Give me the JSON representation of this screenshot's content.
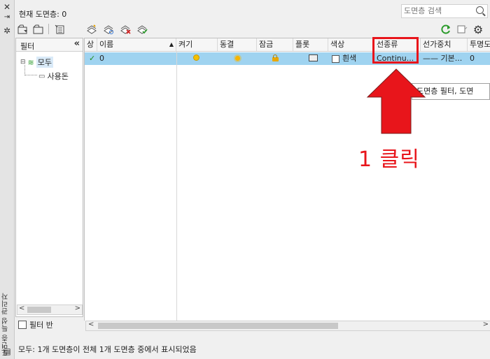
{
  "palette_title": "도면층 특성 관리자",
  "current_layer_label": "현재 도면층: 0",
  "search": {
    "placeholder": "도면층 검색"
  },
  "filter_panel": {
    "header": "필터",
    "tree": [
      {
        "label": "모두",
        "selected": true
      },
      {
        "label": "사용돈"
      }
    ],
    "invert_filter_label": "필터 반"
  },
  "table": {
    "columns": [
      "상",
      "이름",
      "켜기",
      "동결",
      "잠금",
      "플롯",
      "색상",
      "선종류",
      "선가중치",
      "투명도"
    ],
    "rows": [
      {
        "status": "current",
        "name": "0",
        "on": "bulb-on",
        "freeze": "sun-thawed",
        "lock": "unlocked",
        "plot": "printer",
        "color": "흰색",
        "linetype": "Continu...",
        "lineweight": "—— 기본...",
        "transparency": "0"
      }
    ]
  },
  "tooltip": "도면층 필터, 도면",
  "annotation": {
    "text": "1 클릭",
    "color": "#e8151b"
  },
  "status_text": "모두: 1개 도면층이 전체 1개 도면층 중에서 표시되었음",
  "colors": {
    "selected_row": "#9fd3f0",
    "annotation_red": "#e8151b"
  }
}
